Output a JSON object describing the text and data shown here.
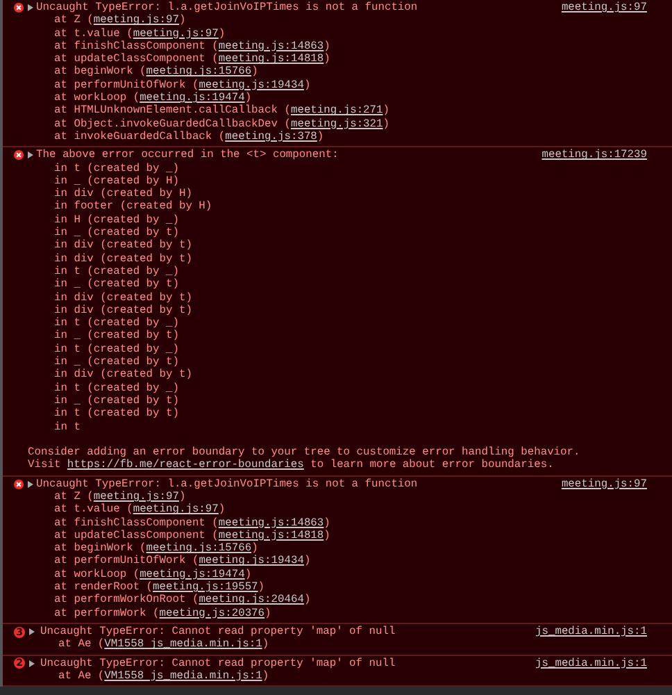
{
  "entries": [
    {
      "kind": "error",
      "message": "Uncaught TypeError: l.a.getJoinVoIPTimes is not a function",
      "source": "meeting.js:97",
      "lines": [
        {
          "before": "at Z (",
          "link": "meeting.js:97",
          "after": ")"
        },
        {
          "before": "at t.value (",
          "link": "meeting.js:97",
          "after": ")"
        },
        {
          "before": "at finishClassComponent (",
          "link": "meeting.js:14863",
          "after": ")"
        },
        {
          "before": "at updateClassComponent (",
          "link": "meeting.js:14818",
          "after": ")"
        },
        {
          "before": "at beginWork (",
          "link": "meeting.js:15766",
          "after": ")"
        },
        {
          "before": "at performUnitOfWork (",
          "link": "meeting.js:19434",
          "after": ")"
        },
        {
          "before": "at workLoop (",
          "link": "meeting.js:19474",
          "after": ")"
        },
        {
          "before": "at HTMLUnknownElement.callCallback (",
          "link": "meeting.js:271",
          "after": ")"
        },
        {
          "before": "at Object.invokeGuardedCallbackDev (",
          "link": "meeting.js:321",
          "after": ")"
        },
        {
          "before": "at invokeGuardedCallback (",
          "link": "meeting.js:378",
          "after": ")"
        }
      ]
    },
    {
      "kind": "error",
      "message": "The above error occurred in the <t> component:",
      "source": "meeting.js:17239",
      "lines": [
        {
          "before": "in t (created by _)"
        },
        {
          "before": "in _ (created by H)"
        },
        {
          "before": "in div (created by H)"
        },
        {
          "before": "in footer (created by H)"
        },
        {
          "before": "in H (created by _)"
        },
        {
          "before": "in _ (created by t)"
        },
        {
          "before": "in div (created by t)"
        },
        {
          "before": "in div (created by t)"
        },
        {
          "before": "in t (created by _)"
        },
        {
          "before": "in _ (created by t)"
        },
        {
          "before": "in div (created by t)"
        },
        {
          "before": "in div (created by t)"
        },
        {
          "before": "in t (created by _)"
        },
        {
          "before": "in _ (created by t)"
        },
        {
          "before": "in t (created by _)"
        },
        {
          "before": "in _ (created by t)"
        },
        {
          "before": "in div (created by t)"
        },
        {
          "before": "in t (created by _)"
        },
        {
          "before": "in _ (created by t)"
        },
        {
          "before": "in t (created by t)"
        },
        {
          "before": "in t"
        }
      ],
      "notes": [
        {
          "before": "Consider adding an error boundary to your tree to customize error handling behavior."
        },
        {
          "before": "Visit ",
          "link": "https://fb.me/react-error-boundaries",
          "after": " to learn more about error boundaries."
        }
      ]
    },
    {
      "kind": "error",
      "message": "Uncaught TypeError: l.a.getJoinVoIPTimes is not a function",
      "source": "meeting.js:97",
      "lines": [
        {
          "before": "at Z (",
          "link": "meeting.js:97",
          "after": ")"
        },
        {
          "before": "at t.value (",
          "link": "meeting.js:97",
          "after": ")"
        },
        {
          "before": "at finishClassComponent (",
          "link": "meeting.js:14863",
          "after": ")"
        },
        {
          "before": "at updateClassComponent (",
          "link": "meeting.js:14818",
          "after": ")"
        },
        {
          "before": "at beginWork (",
          "link": "meeting.js:15766",
          "after": ")"
        },
        {
          "before": "at performUnitOfWork (",
          "link": "meeting.js:19434",
          "after": ")"
        },
        {
          "before": "at workLoop (",
          "link": "meeting.js:19474",
          "after": ")"
        },
        {
          "before": "at renderRoot (",
          "link": "meeting.js:19557",
          "after": ")"
        },
        {
          "before": "at performWorkOnRoot (",
          "link": "meeting.js:20464",
          "after": ")"
        },
        {
          "before": "at performWork (",
          "link": "meeting.js:20376",
          "after": ")"
        }
      ]
    },
    {
      "kind": "repeated",
      "count": "3",
      "message": "Uncaught TypeError: Cannot read property 'map' of null",
      "source": "js_media.min.js:1",
      "lines": [
        {
          "before": "at Ae (",
          "link": "VM1558 js_media.min.js:1",
          "after": ")"
        }
      ]
    },
    {
      "kind": "repeated",
      "count": "2",
      "message": "Uncaught TypeError: Cannot read property 'map' of null",
      "source": "js_media.min.js:1",
      "lines": [
        {
          "before": "at Ae (",
          "link": "VM1558 js_media.min.js:1",
          "after": ")"
        }
      ]
    }
  ]
}
